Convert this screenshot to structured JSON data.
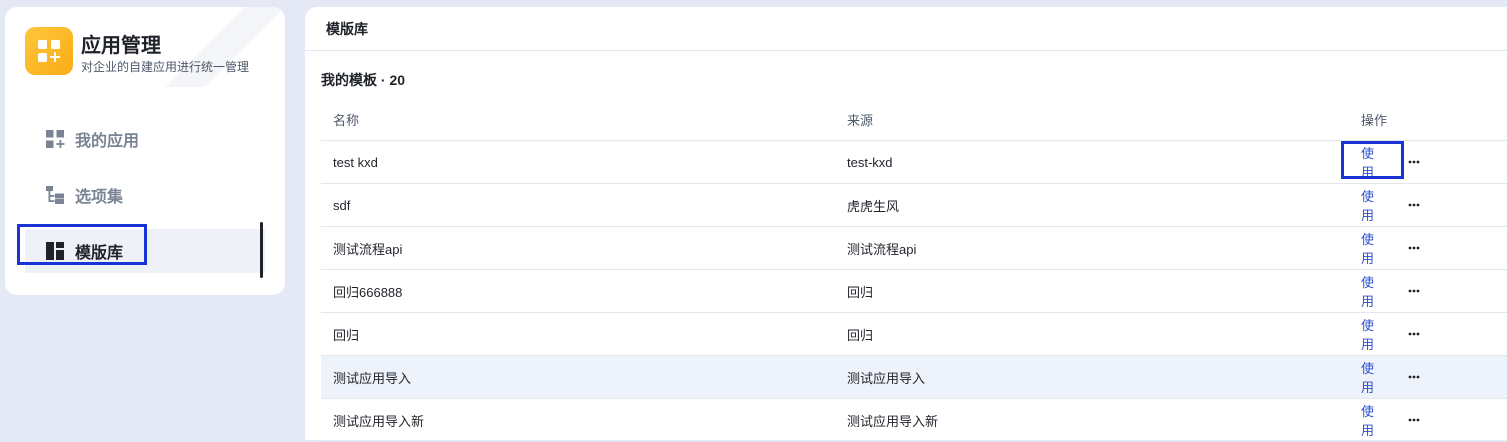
{
  "colors": {
    "accent": "#2b4fd1",
    "highlight": "#1a33d6",
    "logo": "#faad14"
  },
  "sidebar": {
    "app_title": "应用管理",
    "app_subtitle": "对企业的自建应用进行统一管理",
    "items": [
      {
        "label": "我的应用",
        "icon": "apps-add-icon"
      },
      {
        "label": "选项集",
        "icon": "tree-icon"
      },
      {
        "label": "模版库",
        "icon": "layout-icon",
        "active": true
      }
    ]
  },
  "main": {
    "header_title": "模版库",
    "section_title": "我的模板 · 20",
    "columns": {
      "name": "名称",
      "source": "来源",
      "actions": "操作"
    },
    "rows": [
      {
        "name": "test kxd",
        "source": "test-kxd",
        "action": "使用"
      },
      {
        "name": "sdf",
        "source": "虎虎生风",
        "action": "使用"
      },
      {
        "name": "测试流程api",
        "source": "测试流程api",
        "action": "使用"
      },
      {
        "name": "回归666888",
        "source": "回归",
        "action": "使用"
      },
      {
        "name": "回归",
        "source": "回归",
        "action": "使用"
      },
      {
        "name": "测试应用导入",
        "source": "测试应用导入",
        "action": "使用"
      },
      {
        "name": "测试应用导入新",
        "source": "测试应用导入新",
        "action": "使用"
      }
    ]
  }
}
